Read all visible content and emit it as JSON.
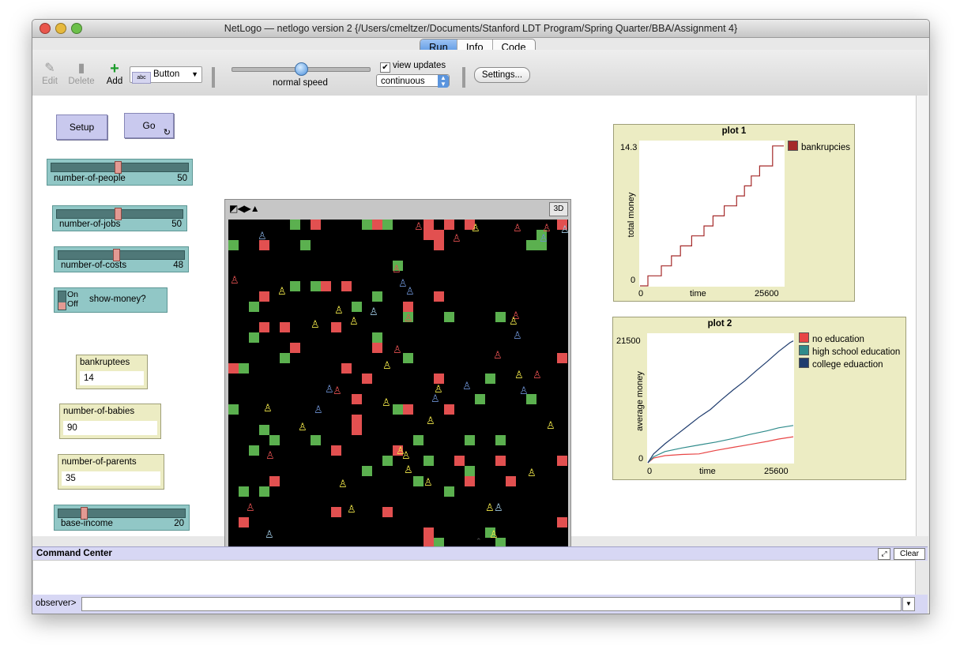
{
  "window": {
    "title": "NetLogo — netlogo version 2 {/Users/cmeltzer/Documents/Stanford LDT Program/Spring Quarter/BBA/Assignment 4}",
    "tabs": [
      "Run",
      "Info",
      "Code"
    ],
    "active_tab": "Run"
  },
  "toolbar": {
    "edit": "Edit",
    "delete": "Delete",
    "add": "Add",
    "widget_type": "Button",
    "speed_label": "normal speed",
    "speed": 0.5,
    "view_updates_label": "view updates",
    "view_updates_checked": true,
    "update_mode": "continuous",
    "settings": "Settings..."
  },
  "widgets": {
    "setup": "Setup",
    "go": "Go",
    "sliders": [
      {
        "name": "number-of-people",
        "value": "50",
        "fraction": 0.45
      },
      {
        "name": "number-of-jobs",
        "value": "50",
        "fraction": 0.45
      },
      {
        "name": "number-of-costs",
        "value": "48",
        "fraction": 0.43
      },
      {
        "name": "base-income",
        "value": "20",
        "fraction": 0.2
      }
    ],
    "switch": {
      "name": "show-money?",
      "on": "On",
      "off": "Off"
    },
    "monitors": [
      {
        "name": "bankruptees",
        "value": "14"
      },
      {
        "name": "number-of-babies",
        "value": "90"
      },
      {
        "name": "number-of-parents",
        "value": "35"
      }
    ]
  },
  "view": {
    "button_3d": "3D"
  },
  "plot1": {
    "title": "plot 1",
    "ylabel": "total money",
    "xlabel": "time",
    "xmin": "0",
    "xmax": "25600",
    "ymin": "0",
    "ymax": "14.3",
    "legend": [
      {
        "name": "bankrupcies",
        "color": "#a52a2a"
      }
    ]
  },
  "plot2": {
    "title": "plot 2",
    "ylabel": "average money",
    "xlabel": "time",
    "xmin": "0",
    "xmax": "25600",
    "ymin": "0",
    "ymax": "21500",
    "legend": [
      {
        "name": "no education",
        "color": "#e84545"
      },
      {
        "name": "high school education",
        "color": "#2f8b8b"
      },
      {
        "name": "college eduaction",
        "color": "#1f3c6e"
      }
    ]
  },
  "chart_data": [
    {
      "type": "line",
      "title": "plot 1",
      "xlabel": "time",
      "ylabel": "total money",
      "xlim": [
        0,
        25600
      ],
      "ylim": [
        0,
        14.3
      ],
      "series": [
        {
          "name": "bankrupcies",
          "color": "#a52a2a",
          "x": [
            0,
            1400,
            1400,
            3800,
            3800,
            5600,
            5600,
            7200,
            7200,
            9200,
            9200,
            11400,
            11400,
            13000,
            13000,
            15000,
            15000,
            17200,
            17200,
            18600,
            18600,
            19800,
            19800,
            21300,
            21300,
            23600,
            23600,
            25600
          ],
          "y": [
            0,
            0,
            1,
            1,
            2,
            2,
            3,
            3,
            4,
            4,
            5,
            5,
            6,
            6,
            7,
            7,
            8,
            8,
            9,
            9,
            10,
            10,
            11,
            11,
            12,
            12,
            14,
            14
          ]
        }
      ]
    },
    {
      "type": "line",
      "title": "plot 2",
      "xlabel": "time",
      "ylabel": "average money",
      "xlim": [
        0,
        25600
      ],
      "ylim": [
        0,
        21500
      ],
      "series": [
        {
          "name": "no education",
          "color": "#e84545",
          "x": [
            0,
            1000,
            3000,
            6000,
            9000,
            12000,
            15000,
            18000,
            21000,
            23000,
            25600
          ],
          "y": [
            0,
            800,
            1200,
            1400,
            1500,
            2100,
            2600,
            3100,
            3600,
            4000,
            4400
          ]
        },
        {
          "name": "high school education",
          "color": "#2f8b8b",
          "x": [
            0,
            1000,
            3000,
            6000,
            9000,
            12000,
            15000,
            18000,
            21000,
            23000,
            25600
          ],
          "y": [
            0,
            1000,
            1900,
            2500,
            3000,
            3500,
            4100,
            4800,
            5400,
            5900,
            6300
          ]
        },
        {
          "name": "college eduaction",
          "color": "#1f3c6e",
          "x": [
            0,
            1000,
            3000,
            5000,
            7000,
            9000,
            11000,
            13000,
            15000,
            17000,
            19000,
            21000,
            23000,
            25000,
            25600
          ],
          "y": [
            0,
            1500,
            3200,
            4700,
            6200,
            7700,
            9000,
            10700,
            12300,
            13800,
            15500,
            17100,
            18800,
            20300,
            20600
          ]
        }
      ]
    }
  ],
  "command_center": {
    "title": "Command Center",
    "clear": "Clear",
    "prompt": "observer>",
    "input": ""
  }
}
